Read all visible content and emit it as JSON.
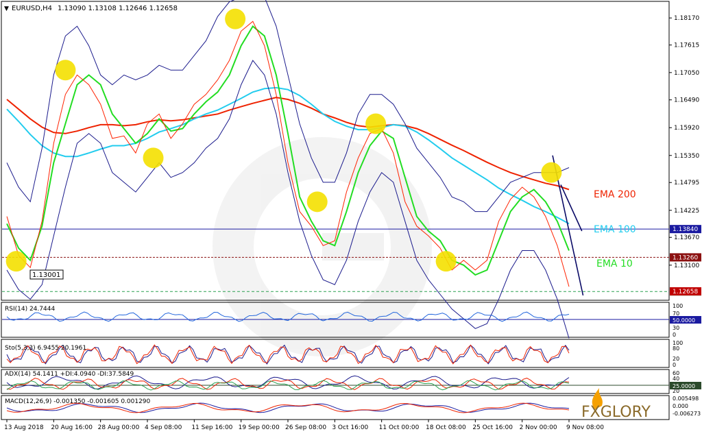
{
  "header": {
    "symbol": "EURUSD,H4",
    "ohlc": "1.13090 1.13108 1.12646 1.12658"
  },
  "chart_data": {
    "type": "line",
    "title": "EURUSD,H4 1.13090 1.13108 1.12646 1.12658",
    "ylim": [
      1.1238,
      1.1851
    ],
    "y_ticks": [
      "1.18170",
      "1.17615",
      "1.17050",
      "1.16490",
      "1.15920",
      "1.15350",
      "1.14795",
      "1.14225",
      "1.13670",
      "1.13100"
    ],
    "x_ticks": [
      "13 Aug 2018",
      "20 Aug 16:00",
      "28 Aug 00:00",
      "4 Sep 08:00",
      "11 Sep 16:00",
      "19 Sep 00:00",
      "26 Sep 08:00",
      "3 Oct 16:00",
      "11 Oct 00:00",
      "18 Oct 08:00",
      "25 Oct 16:00",
      "2 Nov 00:00",
      "9 Nov 08:00"
    ],
    "x_index": [
      0,
      4,
      8,
      12,
      16,
      20,
      24,
      28,
      32,
      36,
      40,
      44,
      48
    ],
    "series": [
      {
        "name": "EMA 200",
        "color": "#ee2200",
        "values": [
          1.165,
          1.163,
          1.161,
          1.1593,
          1.1582,
          1.158,
          1.1585,
          1.1592,
          1.1598,
          1.1598,
          1.1596,
          1.1598,
          1.1604,
          1.1608,
          1.1606,
          1.1608,
          1.1612,
          1.1616,
          1.162,
          1.1628,
          1.1635,
          1.1642,
          1.1648,
          1.1654,
          1.165,
          1.1642,
          1.1632,
          1.162,
          1.1612,
          1.1603,
          1.1596,
          1.1593,
          1.1596,
          1.1598,
          1.1596,
          1.159,
          1.158,
          1.1568,
          1.1556,
          1.1545,
          1.1533,
          1.1521,
          1.151,
          1.15,
          1.1492,
          1.1485,
          1.1478,
          1.1473,
          1.1465
        ]
      },
      {
        "name": "EMA 100",
        "color": "#22ccee",
        "values": [
          1.163,
          1.1605,
          1.1578,
          1.1555,
          1.154,
          1.1533,
          1.1533,
          1.154,
          1.1548,
          1.1555,
          1.1555,
          1.156,
          1.157,
          1.1583,
          1.159,
          1.1598,
          1.161,
          1.162,
          1.1628,
          1.164,
          1.1652,
          1.1665,
          1.1672,
          1.1674,
          1.167,
          1.1658,
          1.164,
          1.162,
          1.1605,
          1.1595,
          1.1588,
          1.1588,
          1.1592,
          1.1598,
          1.1595,
          1.1583,
          1.1567,
          1.1549,
          1.153,
          1.1515,
          1.15,
          1.1485,
          1.1468,
          1.1455,
          1.1443,
          1.143,
          1.142,
          1.1408,
          1.1395
        ]
      },
      {
        "name": "EMA 10",
        "color": "#22dd22",
        "values": [
          1.1395,
          1.1345,
          1.132,
          1.139,
          1.152,
          1.16,
          1.168,
          1.17,
          1.168,
          1.162,
          1.159,
          1.156,
          1.158,
          1.161,
          1.1585,
          1.159,
          1.162,
          1.1645,
          1.1665,
          1.17,
          1.176,
          1.18,
          1.178,
          1.17,
          1.158,
          1.145,
          1.14,
          1.136,
          1.135,
          1.142,
          1.15,
          1.1555,
          1.1585,
          1.157,
          1.149,
          1.141,
          1.138,
          1.136,
          1.132,
          1.131,
          1.129,
          1.13,
          1.136,
          1.142,
          1.145,
          1.1465,
          1.144,
          1.14,
          1.134
        ]
      },
      {
        "name": "",
        "color": "#ff2200",
        "values": [
          1.141,
          1.133,
          1.1305,
          1.14,
          1.156,
          1.166,
          1.17,
          1.168,
          1.164,
          1.157,
          1.1575,
          1.154,
          1.16,
          1.162,
          1.157,
          1.16,
          1.164,
          1.166,
          1.169,
          1.173,
          1.179,
          1.181,
          1.176,
          1.166,
          1.152,
          1.142,
          1.139,
          1.135,
          1.136,
          1.146,
          1.153,
          1.158,
          1.159,
          1.154,
          1.144,
          1.139,
          1.137,
          1.1345,
          1.13,
          1.132,
          1.13,
          1.132,
          1.14,
          1.1445,
          1.147,
          1.145,
          1.141,
          1.135,
          1.1266
        ]
      },
      {
        "name": "",
        "color": "#1a1a8c",
        "values": [
          1.152,
          1.147,
          1.144,
          1.155,
          1.17,
          1.178,
          1.18,
          1.176,
          1.17,
          1.168,
          1.17,
          1.169,
          1.17,
          1.172,
          1.171,
          1.171,
          1.174,
          1.177,
          1.182,
          1.185,
          1.186,
          1.187,
          1.186,
          1.18,
          1.17,
          1.16,
          1.153,
          1.148,
          1.148,
          1.154,
          1.162,
          1.166,
          1.166,
          1.164,
          1.16,
          1.155,
          1.152,
          1.149,
          1.145,
          1.144,
          1.142,
          1.142,
          1.145,
          1.148,
          1.149,
          1.15,
          1.15,
          1.15,
          1.151
        ]
      },
      {
        "name": "",
        "color": "#1a1a8c",
        "values": [
          1.13,
          1.126,
          1.124,
          1.127,
          1.137,
          1.147,
          1.156,
          1.158,
          1.156,
          1.15,
          1.148,
          1.146,
          1.149,
          1.152,
          1.149,
          1.15,
          1.152,
          1.155,
          1.157,
          1.161,
          1.168,
          1.173,
          1.17,
          1.162,
          1.15,
          1.14,
          1.133,
          1.128,
          1.127,
          1.132,
          1.14,
          1.146,
          1.15,
          1.148,
          1.14,
          1.132,
          1.128,
          1.125,
          1.122,
          1.12,
          1.118,
          1.119,
          1.124,
          1.13,
          1.134,
          1.134,
          1.13,
          1.124,
          1.116
        ]
      }
    ],
    "h_levels": [
      {
        "label": "1.13840",
        "value": 1.1384,
        "color": "#1a1aa0",
        "style": "solid"
      },
      {
        "label": "1.13260",
        "value": 1.1326,
        "color": "#8b1010",
        "style": "dotted"
      },
      {
        "label": "1.12560",
        "value": 1.1256,
        "color": "#2aa050",
        "style": "dashed"
      }
    ],
    "price_label": "1.12658",
    "annotation_low": "1.13001",
    "trend_lines": [
      {
        "x1": 46.6,
        "y1": 1.1535,
        "x2": 49.2,
        "y2": 1.1248
      },
      {
        "x1": 47.3,
        "y1": 1.1475,
        "x2": 49.1,
        "y2": 1.138
      }
    ],
    "markers_x": [
      0.8,
      5.0,
      12.5,
      19.5,
      26.5,
      31.5,
      37.5,
      46.5
    ],
    "markers_y": [
      1.1318,
      1.171,
      1.153,
      1.1815,
      1.144,
      1.16,
      1.1318,
      1.15
    ],
    "ema_labels": [
      {
        "text": "EMA 200",
        "color": "#ee2200"
      },
      {
        "text": "EMA 100",
        "color": "#22ccee"
      },
      {
        "text": "EMA 10",
        "color": "#22dd22"
      }
    ],
    "indicators": {
      "rsi": {
        "label": "RSI(14) 24.7444",
        "ticks": [
          "100",
          "70",
          "50.0000",
          "30",
          "0"
        ],
        "level": "50.0000"
      },
      "sto": {
        "label": "Sto(5,3,3) 6.9455 20.1961",
        "ticks": [
          "100",
          "80",
          "20",
          "0"
        ]
      },
      "adx": {
        "label": "ADX(14) 54.1411 +DI:4.0940 -DI:37.5849",
        "ticks": [
          "60",
          "40",
          "25.0000",
          "20"
        ],
        "level": "25.0000"
      },
      "macd": {
        "label": "MACD(12,26,9) -0.001350 -0.001605 0.001290",
        "ticks": [
          "0.005498",
          "0.000",
          "-0.006273"
        ]
      }
    }
  },
  "logo": {
    "text": "FXGLORY"
  }
}
